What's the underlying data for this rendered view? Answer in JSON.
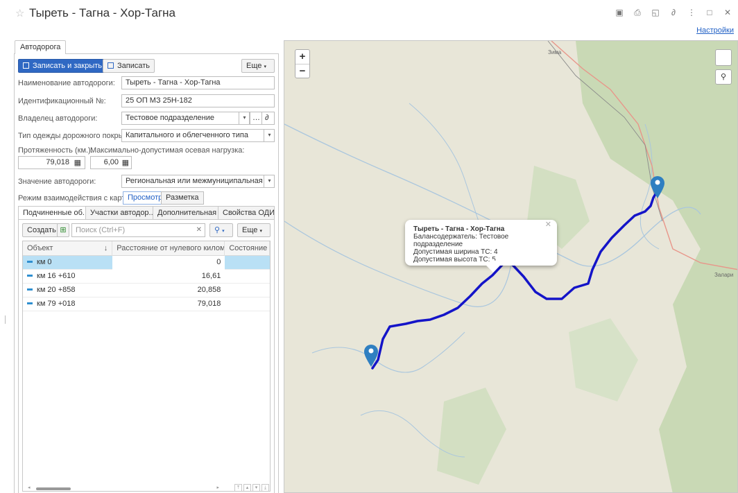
{
  "window": {
    "title": "Тыреть - Тагна - Хор-Тагна",
    "settings_link": "Настройки"
  },
  "form": {
    "tab_main": "Автодорога",
    "toolbar": {
      "save_close": "Записать и закрыть",
      "save": "Записать",
      "more": "Еще"
    },
    "fields": {
      "name_label": "Наименование автодороги:",
      "name_value": "Тыреть - Тагна - Хор-Тагна",
      "id_label": "Идентификационный №:",
      "id_value": "25 ОП МЗ 25Н-182",
      "owner_label": "Владелец автодороги:",
      "owner_value": "Тестовое подразделение",
      "surface_label": "Тип одежды дорожного покрытия:",
      "surface_value": "Капитального и облегченного типа",
      "length_label": "Протяженность (км.):",
      "length_value": "79,018",
      "axle_label": "Максимально-допустимая осевая нагрузка:",
      "axle_value": "6,00",
      "significance_label": "Значение автодороги:",
      "significance_value": "Региональная или межмуниципальная",
      "map_mode_label": "Режим взаимодействия с картой:",
      "map_mode_view": "Просмотр",
      "map_mode_markup": "Разметка"
    },
    "subtabs": [
      "Подчиненные об...",
      "Участки автодор...",
      "Дополнительная ...",
      "Свойства ОДИ"
    ],
    "subtoolbar": {
      "create": "Создать",
      "search_placeholder": "Поиск (Ctrl+F)",
      "more": "Еще"
    },
    "table": {
      "columns": [
        "Объект",
        "Расстояние от нулевого километра",
        "Состояние о"
      ],
      "rows": [
        {
          "object": "км 0",
          "distance": "0"
        },
        {
          "object": "км 16 +610",
          "distance": "16,61"
        },
        {
          "object": "км 20 +858",
          "distance": "20,858"
        },
        {
          "object": "км 79 +018",
          "distance": "79,018"
        }
      ]
    }
  },
  "map": {
    "popup": {
      "title": "Тыреть - Тагна - Хор-Тагна",
      "line1": "Балансодержатель: Тестовое подразделение",
      "line2": "Допустимая ширина ТС: 4",
      "line3": "Допустимая высота ТС: 5"
    },
    "labels": {
      "zima": "Зима",
      "zalari": "Залари"
    },
    "route_color": "#1414c8"
  }
}
